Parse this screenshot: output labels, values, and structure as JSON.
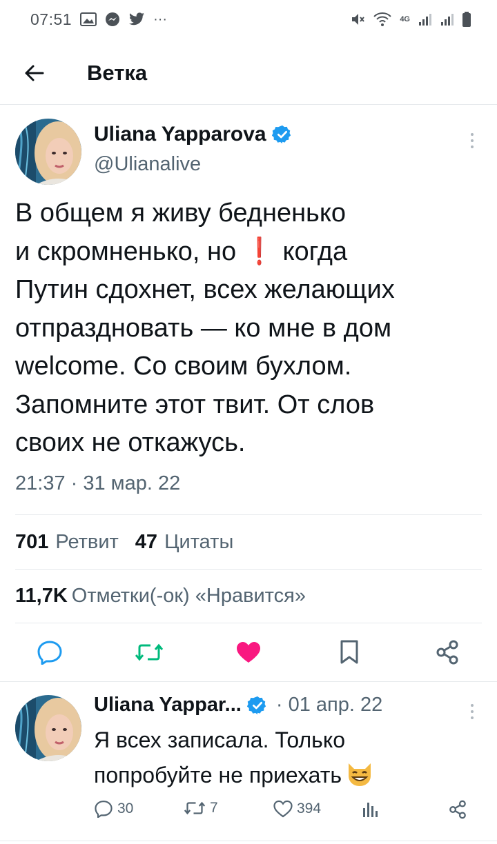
{
  "status_bar": {
    "time": "07:51",
    "network_label": "4G",
    "more": "···",
    "icons": [
      "gallery-icon",
      "messenger-icon",
      "twitter-icon",
      "mute-icon",
      "wifi-icon",
      "signal-icon",
      "signal-icon",
      "battery-icon"
    ]
  },
  "header": {
    "title": "Ветка",
    "back_icon": "arrow-left-icon"
  },
  "tweet": {
    "author_name": "Uliana Yapparova",
    "handle": "@Ulianalive",
    "verified": true,
    "lines": [
      "В  общем я живу бедненько",
      "и скромненько, но",
      "когда",
      "Путин сдохнет, всех желающих",
      "отпраздновать — ко мне в дом",
      "welcome. Со своим бухлом.",
      "Запомните этот твит. От слов",
      "своих не откажусь."
    ],
    "exclamation": "❗",
    "time": "21:37 · 31 мар. 22",
    "stats": {
      "retweets": "701",
      "retweets_label": "Ретвит",
      "quotes": "47",
      "quotes_label": "Цитаты",
      "likes": "11,7K",
      "likes_label": "Отметки(-ок) «Нравится»"
    },
    "actions": [
      "reply-icon",
      "retweet-icon",
      "like-icon",
      "bookmark-icon",
      "share-icon"
    ]
  },
  "reply": {
    "author_name": "Uliana Yappar...",
    "date": "· 01 апр. 22",
    "verified": true,
    "lines": [
      "Я всех записала. Только",
      "попробуйте не приехать"
    ],
    "emoji": "😸",
    "replies": "30",
    "retweets": "7",
    "likes": "394"
  },
  "colors": {
    "accent_blue": "#1d9bf0",
    "retweet_green": "#00ba7c",
    "like_pink": "#f91880",
    "text_primary": "#0f1419",
    "text_secondary": "#536471"
  }
}
